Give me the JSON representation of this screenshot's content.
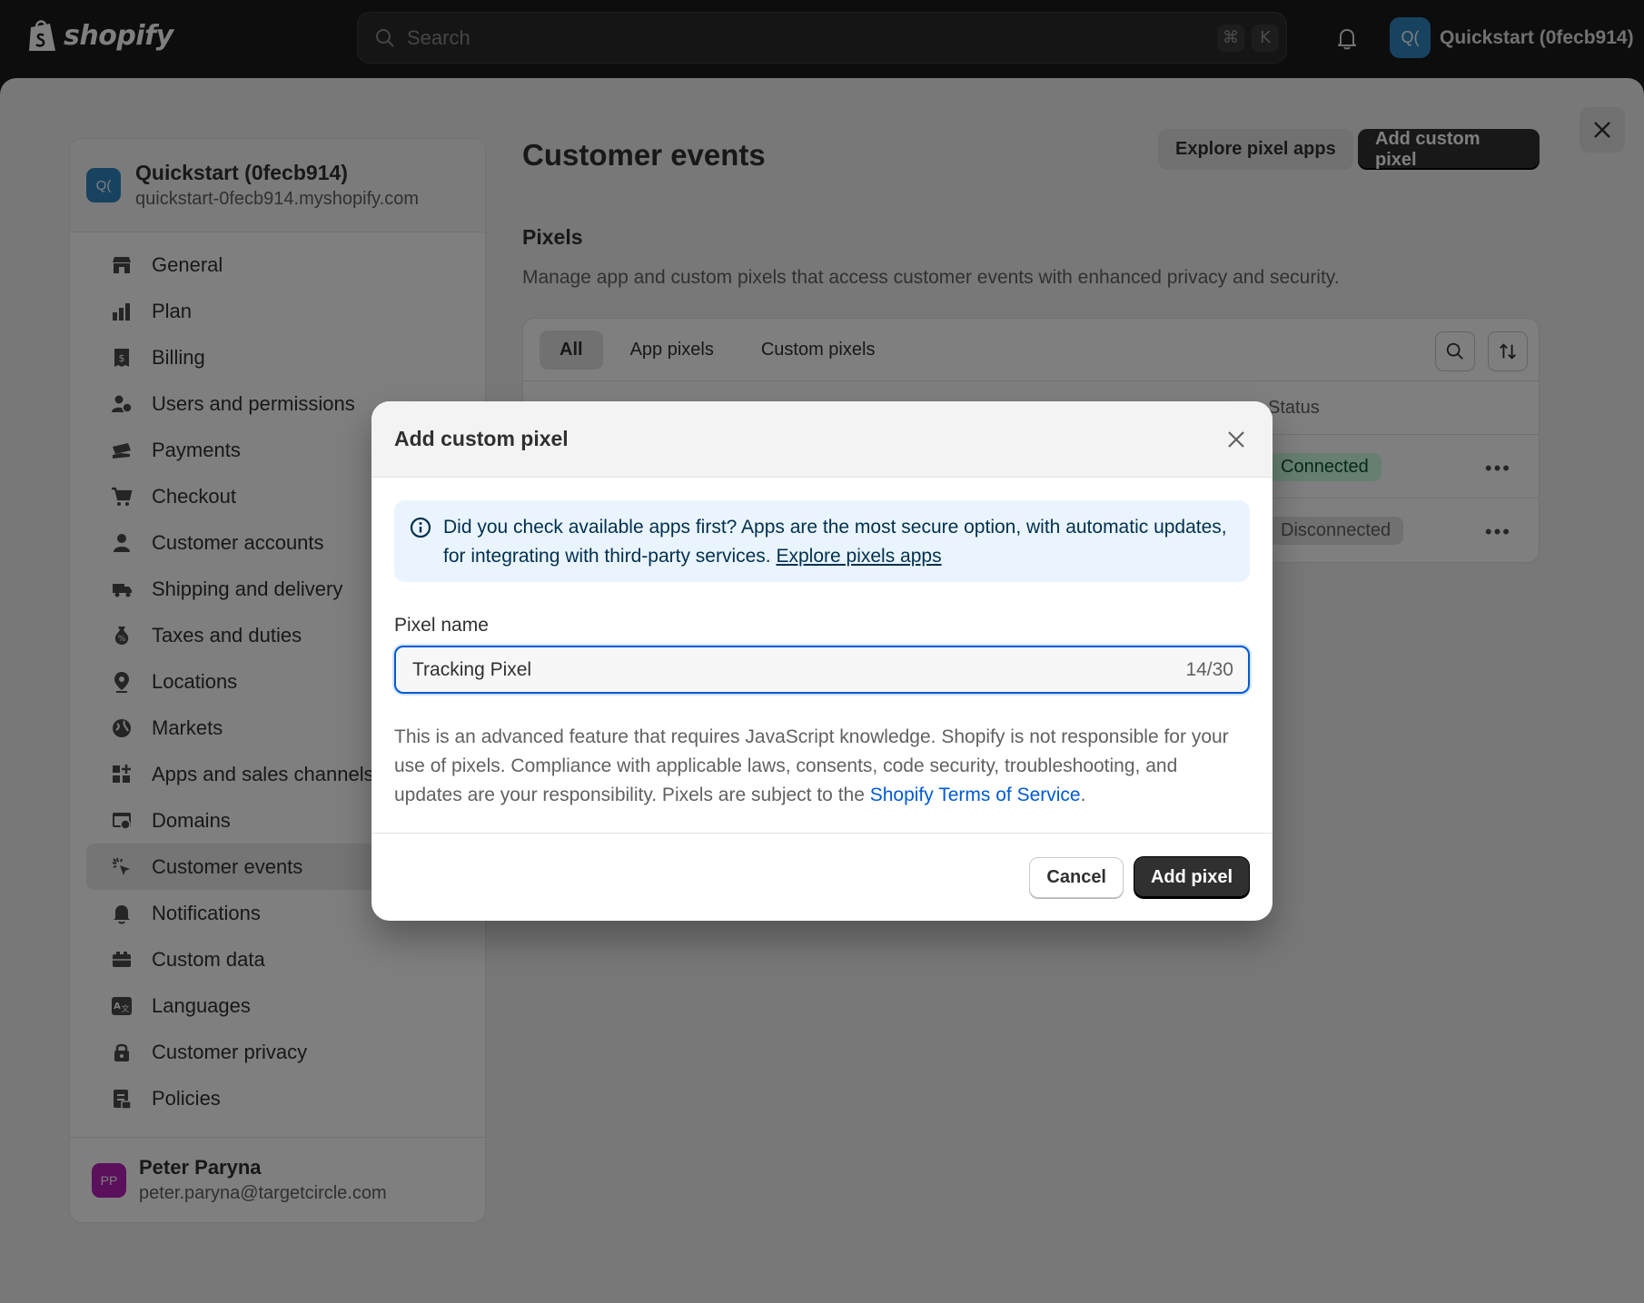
{
  "topbar": {
    "logo_text": "shopify",
    "search_placeholder": "Search",
    "shortcut_keys": [
      "⌘",
      "K"
    ],
    "store_avatar": "Q(",
    "store_name": "Quickstart (0fecb914)"
  },
  "sidebar": {
    "store_avatar": "Q(",
    "store_title": "Quickstart (0fecb914)",
    "store_domain": "quickstart-0fecb914.myshopify.com",
    "items": [
      {
        "label": "General",
        "icon": "store-icon"
      },
      {
        "label": "Plan",
        "icon": "plan-icon"
      },
      {
        "label": "Billing",
        "icon": "billing-icon"
      },
      {
        "label": "Users and permissions",
        "icon": "users-icon"
      },
      {
        "label": "Payments",
        "icon": "payments-icon"
      },
      {
        "label": "Checkout",
        "icon": "cart-icon"
      },
      {
        "label": "Customer accounts",
        "icon": "person-icon"
      },
      {
        "label": "Shipping and delivery",
        "icon": "truck-icon"
      },
      {
        "label": "Taxes and duties",
        "icon": "taxes-icon"
      },
      {
        "label": "Locations",
        "icon": "location-pin-icon"
      },
      {
        "label": "Markets",
        "icon": "globe-icon"
      },
      {
        "label": "Apps and sales channels",
        "icon": "apps-icon"
      },
      {
        "label": "Domains",
        "icon": "domains-icon"
      },
      {
        "label": "Customer events",
        "icon": "cursor-click-icon",
        "active": true
      },
      {
        "label": "Notifications",
        "icon": "bell-icon"
      },
      {
        "label": "Custom data",
        "icon": "database-icon"
      },
      {
        "label": "Languages",
        "icon": "translate-icon"
      },
      {
        "label": "Customer privacy",
        "icon": "lock-icon"
      },
      {
        "label": "Policies",
        "icon": "policies-icon"
      }
    ],
    "user": {
      "avatar": "PP",
      "name": "Peter Paryna",
      "email": "peter.paryna@targetcircle.com"
    }
  },
  "main": {
    "title": "Customer events",
    "explore_button": "Explore pixel apps",
    "add_button": "Add custom pixel",
    "section_title": "Pixels",
    "section_desc": "Manage app and custom pixels that access customer events with enhanced privacy and security.",
    "tabs": [
      {
        "label": "All",
        "active": true
      },
      {
        "label": "App pixels"
      },
      {
        "label": "Custom pixels"
      }
    ],
    "status_header": "Status",
    "rows": [
      {
        "status": "Connected",
        "kind": "ok"
      },
      {
        "status": "Disconnected",
        "kind": "off"
      }
    ],
    "more_label": "•••"
  },
  "dialog": {
    "title": "Add custom pixel",
    "banner_text": "Did you check available apps first? Apps are the most secure option, with automatic updates, for integrating with third-party services. ",
    "banner_link": "Explore pixels apps",
    "field_label": "Pixel name",
    "field_value": "Tracking Pixel",
    "field_count": "14/30",
    "helper_text": "This is an advanced feature that requires JavaScript knowledge. Shopify is not responsible for your use of pixels. Compliance with applicable laws, consents, code security, troubleshooting, and updates are your responsibility. Pixels are subject to the ",
    "helper_link": "Shopify Terms of Service",
    "helper_end": ".",
    "cancel_button": "Cancel",
    "add_button": "Add pixel"
  },
  "colors": {
    "accent": "#005bd3",
    "primary_button": "#303030",
    "success_badge": "#cdfee1",
    "info_banner": "#eaf4ff"
  }
}
